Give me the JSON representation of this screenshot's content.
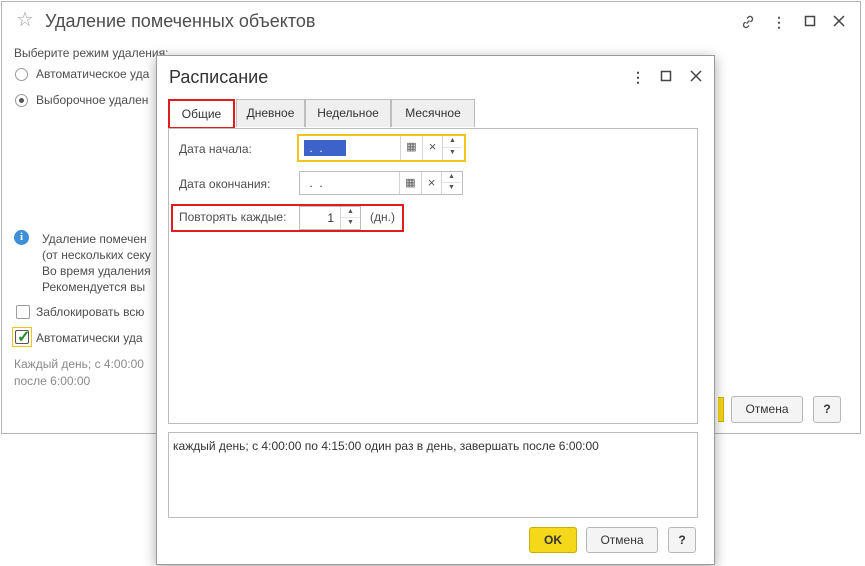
{
  "background_window": {
    "title": "Удаление помеченных объектов",
    "mode_label": "Выберите режим удаления:",
    "radio_auto": "Автоматическое уда",
    "radio_selective": "Выборочное удален",
    "info_lines": [
      "Удаление помечен",
      "(от нескольких секу",
      "Во время удаления",
      "Рекомендуется вы"
    ],
    "lock_checkbox": "Заблокировать всю",
    "auto_delete_checkbox": "Автоматически уда",
    "schedule_line1": "Каждый день; с 4:00:00",
    "schedule_line2": "после 6:00:00",
    "cancel_label": "Отмена",
    "help_label": "?"
  },
  "dialog": {
    "title": "Расписание",
    "tabs": [
      {
        "label": "Общие",
        "active": true
      },
      {
        "label": "Дневное",
        "active": false
      },
      {
        "label": "Недельное",
        "active": false
      },
      {
        "label": "Месячное",
        "active": false
      }
    ],
    "start_date_label": "Дата начала:",
    "start_date_value": " .  .",
    "end_date_label": "Дата окончания:",
    "end_date_value": " .  .",
    "repeat_label": "Повторять каждые:",
    "repeat_value": "1",
    "repeat_unit": "(дн.)",
    "summary": "каждый день; с 4:00:00 по 4:15:00 один раз в день, завершать после 6:00:00",
    "ok_label": "OK",
    "cancel_label": "Отмена",
    "help_label": "?"
  },
  "icons": {
    "calendar": "▦",
    "clear": "×",
    "spin_up": "▲",
    "spin_down": "▼"
  },
  "colors": {
    "accent_yellow": "#f5d81a",
    "highlight_red": "#e21b1b",
    "selection_blue": "#3b63c9"
  }
}
